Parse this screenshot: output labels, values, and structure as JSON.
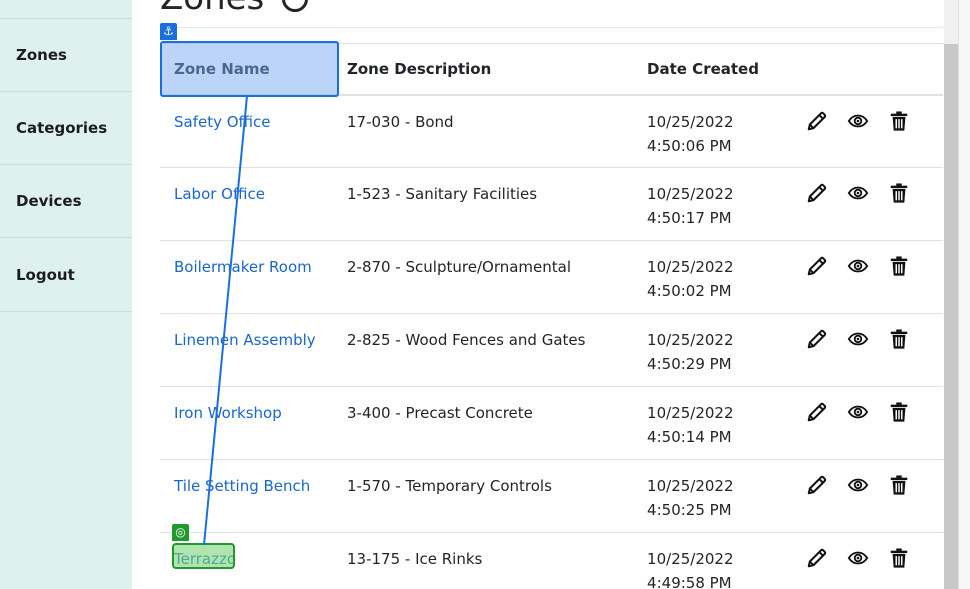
{
  "sidebar": {
    "items": [
      {
        "label": "Zones"
      },
      {
        "label": "Categories"
      },
      {
        "label": "Devices"
      },
      {
        "label": "Logout"
      }
    ]
  },
  "page": {
    "title": "Zones"
  },
  "table": {
    "headers": [
      "Zone Name",
      "Zone Description",
      "Date Created"
    ],
    "rows": [
      {
        "name": "Safety Office",
        "description": "17-030 - Bond",
        "date": "10/25/2022 4:50:06 PM"
      },
      {
        "name": "Labor Office",
        "description": "1-523 - Sanitary Facilities",
        "date": "10/25/2022 4:50:17 PM"
      },
      {
        "name": "Boilermaker Room",
        "description": "2-870 - Sculpture/Ornamental",
        "date": "10/25/2022 4:50:02 PM"
      },
      {
        "name": "Linemen Assembly",
        "description": "2-825 - Wood Fences and Gates",
        "date": "10/25/2022 4:50:29 PM"
      },
      {
        "name": "Iron Workshop",
        "description": "3-400 - Precast Concrete",
        "date": "10/25/2022 4:50:14 PM"
      },
      {
        "name": "Tile Setting Bench",
        "description": "1-570 - Temporary Controls",
        "date": "10/25/2022 4:50:25 PM"
      },
      {
        "name": "Terrazzo",
        "description": "13-175 - Ice Rinks",
        "date": "10/25/2022 4:49:58 PM"
      }
    ],
    "action_icons": [
      "pencil-icon",
      "eye-icon",
      "trash-icon"
    ]
  },
  "annotation": {
    "anchor_glyph": "⚓",
    "target_glyph": "◎",
    "anchor_color": "#1a6fe0",
    "target_color": "#1f9a2b"
  }
}
